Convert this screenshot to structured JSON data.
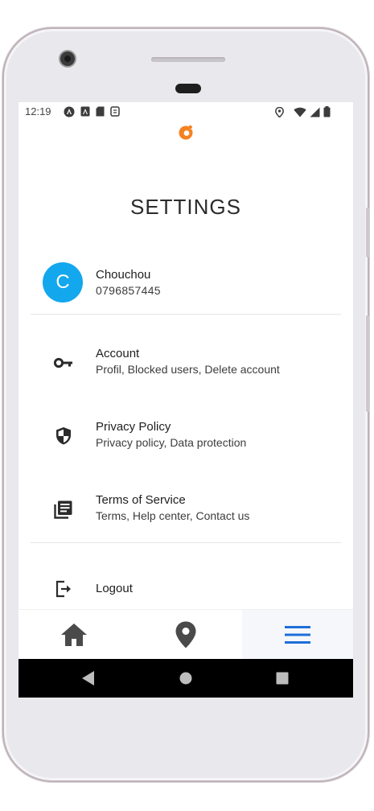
{
  "status_bar": {
    "time": "12:19",
    "left_icons": [
      "angular-icon",
      "a-icon",
      "sd-card-icon",
      "sync-icon"
    ],
    "right_icons": [
      "location-icon",
      "wifi-icon",
      "signal-icon",
      "battery-icon"
    ]
  },
  "header": {
    "title": "SETTINGS",
    "logo_color": "#f58220"
  },
  "profile": {
    "avatar_letter": "C",
    "avatar_color": "#13a7ee",
    "name": "Chouchou",
    "phone": "0796857445"
  },
  "menu": {
    "items": [
      {
        "icon": "key-icon",
        "title": "Account",
        "subtitle": "Profil, Blocked users, Delete account"
      },
      {
        "icon": "shield-icon",
        "title": "Privacy Policy",
        "subtitle": "Privacy policy, Data protection"
      },
      {
        "icon": "articles-icon",
        "title": "Terms of Service",
        "subtitle": "Terms, Help center, Contact us"
      }
    ],
    "logout": {
      "icon": "logout-icon",
      "title": "Logout"
    }
  },
  "bottom_nav": {
    "items": [
      {
        "icon": "home-icon",
        "active": false
      },
      {
        "icon": "location-pin-icon",
        "active": false
      },
      {
        "icon": "menu-icon",
        "active": true
      }
    ],
    "active_color": "#1e6fd9",
    "inactive_color": "#4a4a4a"
  },
  "android_nav": {
    "buttons": [
      "back-icon",
      "home-circle-icon",
      "recents-icon"
    ]
  }
}
